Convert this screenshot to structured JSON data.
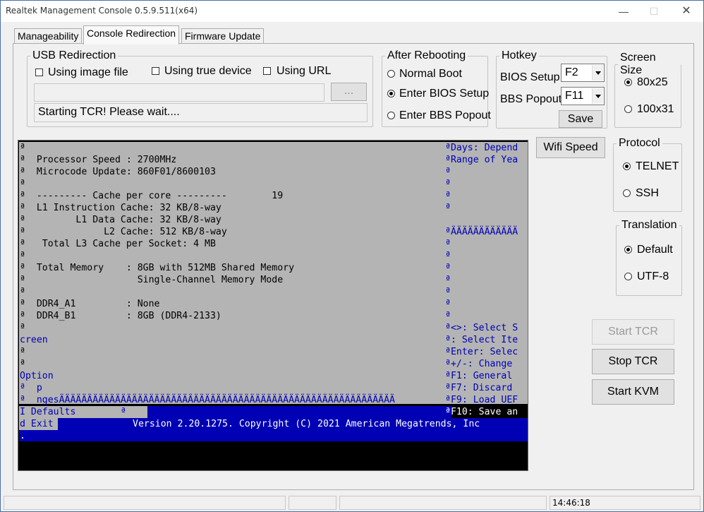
{
  "window": {
    "title": "Realtek Management Console 0.5.9.511(x64)"
  },
  "tabs": [
    {
      "label": "Manageability"
    },
    {
      "label": "Console Redirection"
    },
    {
      "label": "Firmware Update"
    }
  ],
  "usb_redirection": {
    "legend": "USB Redirection",
    "using_image_file": "Using image file",
    "using_true_device": "Using true device",
    "using_url": "Using URL",
    "path_value": "",
    "browse_label": "...",
    "status_text": "Starting TCR! Please wait...."
  },
  "after_rebooting": {
    "legend": "After Rebooting",
    "options": [
      "Normal Boot",
      "Enter BIOS Setup",
      "Enter BBS Popout"
    ],
    "selected": "Enter BIOS Setup"
  },
  "hotkey": {
    "legend": "Hotkey",
    "bios_label": "BIOS Setup",
    "bios_value": "F2",
    "bbs_label": "BBS Popout",
    "bbs_value": "F11",
    "save_label": "Save"
  },
  "screen_size": {
    "legend": "Screen Size",
    "options": [
      "80x25",
      "100x31"
    ],
    "selected": "80x25"
  },
  "wifi_speed_label": "Wifi Speed",
  "protocol": {
    "legend": "Protocol",
    "options": [
      "TELNET",
      "SSH"
    ],
    "selected": "TELNET"
  },
  "translation": {
    "legend": "Translation",
    "options": [
      "Default",
      "UTF-8"
    ],
    "selected": "Default"
  },
  "actions": {
    "start_tcr": "Start TCR",
    "stop_tcr": "Stop TCR",
    "start_kvm": "Start KVM"
  },
  "console": {
    "left_lines": [
      "ª",
      "ª  Processor Speed : 2700MHz",
      "ª  Microcode Update: 860F01/8600103",
      "ª",
      "ª  --------- Cache per core ---------        19",
      "ª  L1 Instruction Cache: 32 KB/8-way",
      "ª         L1 Data Cache: 32 KB/8-way",
      "ª              L2 Cache: 512 KB/8-way",
      "ª   Total L3 Cache per Socket: 4 MB",
      "ª",
      "ª  Total Memory    : 8GB with 512MB Shared Memory",
      "ª                    Single-Channel Memory Mode",
      "ª",
      "ª  DDR4_A1         : None",
      "ª  DDR4_B1         : 8GB (DDR4-2133)",
      "ª",
      "creen",
      "ª",
      "ª",
      "Option",
      "ª  p",
      "ª  ngesÄÄÄÄÄÄÄÄÄÄÄÄÄÄÄÄÄÄÄÄÄÄÄÄÄÄÄÄÄÄÄÄÄÄÄÄÄÄÄÄÄÄÄÄÄÄÄÄÄÄÄÄÄÄÄÄÄÄÄÄ",
      "I Defaults        ª",
      "d Exit",
      "."
    ],
    "right_lines": [
      "ªDays: Depend",
      "ªRange of Yea",
      "ª",
      "ª",
      "ª",
      "ª",
      "ªÄÄÄÄÄÄÄÄÄÄÄÄ",
      "ª",
      "ª",
      "ª",
      "ª",
      "ª",
      "ª",
      "ª",
      "ª<>: Select S",
      "ª: Select Ite",
      "ªEnter: Selec",
      "ª+/-: Change",
      "ªF1: General",
      "ªF7: Discard",
      "ªF9: Load UEF",
      "ªF10: Save an"
    ],
    "copyright": "Version 2.20.1275. Copyright (C) 2021 American Megatrends, Inc"
  },
  "statusbar": {
    "time": "14:46:18"
  }
}
